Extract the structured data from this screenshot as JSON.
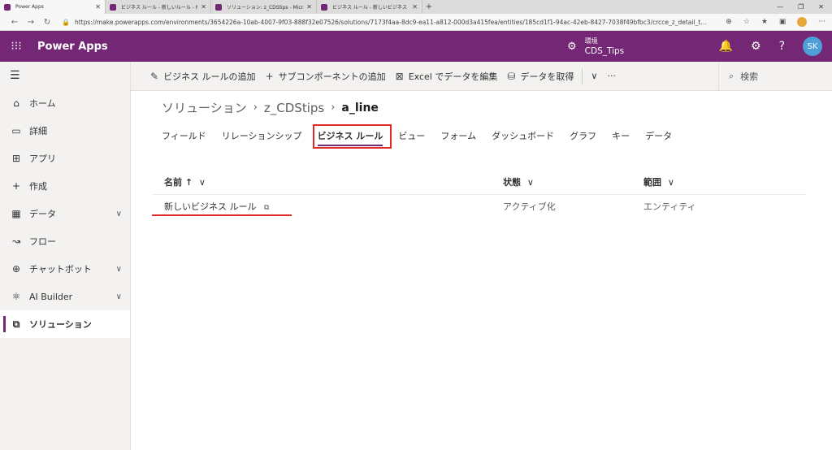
{
  "browser": {
    "tabs": [
      {
        "title": "Power Apps",
        "active": true
      },
      {
        "title": "ビジネス ルール - 新しいルール - Micr",
        "active": false
      },
      {
        "title": "ソリューション: z_CDStips - Microso",
        "active": false
      },
      {
        "title": "ビジネス ルール - 新しいビジネス ル",
        "active": false
      }
    ],
    "new_tab": "+",
    "url": "https://make.powerapps.com/environments/3654226a-10ab-4007-9f03-888f32e07526/solutions/7173f4aa-8dc9-ea11-a812-000d3a415fea/entities/185cd1f1-94ac-42eb-8427-7038f49bfbc3/crcce_z_detail_t..."
  },
  "header": {
    "app_name": "Power Apps",
    "env_label": "環境",
    "env_name": "CDS_Tips",
    "avatar_initials": "SK"
  },
  "sidebar": {
    "items": [
      {
        "label": "ホーム",
        "icon": "home-icon"
      },
      {
        "label": "詳細",
        "icon": "book-icon"
      },
      {
        "label": "アプリ",
        "icon": "apps-icon"
      },
      {
        "label": "作成",
        "icon": "plus-icon"
      },
      {
        "label": "データ",
        "icon": "table-icon",
        "expandable": true
      },
      {
        "label": "フロー",
        "icon": "flow-icon"
      },
      {
        "label": "チャットボット",
        "icon": "bot-icon",
        "expandable": true
      },
      {
        "label": "AI Builder",
        "icon": "ai-icon",
        "expandable": true
      },
      {
        "label": "ソリューション",
        "icon": "solution-icon",
        "active": true
      }
    ]
  },
  "commands": {
    "add_business_rule": "ビジネス ルールの追加",
    "add_subcomponent": "サブコンポーネントの追加",
    "edit_in_excel": "Excel でデータを編集",
    "get_data": "データを取得",
    "more": "···",
    "search_placeholder": "検索"
  },
  "breadcrumb": {
    "root": "ソリューション",
    "solution": "z_CDStips",
    "entity": "a_line"
  },
  "entity_tabs": [
    "フィールド",
    "リレーションシップ",
    "ビジネス ルール",
    "ビュー",
    "フォーム",
    "ダッシュボード",
    "グラフ",
    "キー",
    "データ"
  ],
  "active_tab_index": 2,
  "grid": {
    "columns": {
      "name": "名前 ↑",
      "state": "状態",
      "scope": "範囲"
    },
    "rows": [
      {
        "name": "新しいビジネス ルール",
        "state": "アクティブ化",
        "scope": "エンティティ"
      }
    ]
  },
  "colors": {
    "brand": "#742774",
    "highlight": "#e02a2a"
  }
}
